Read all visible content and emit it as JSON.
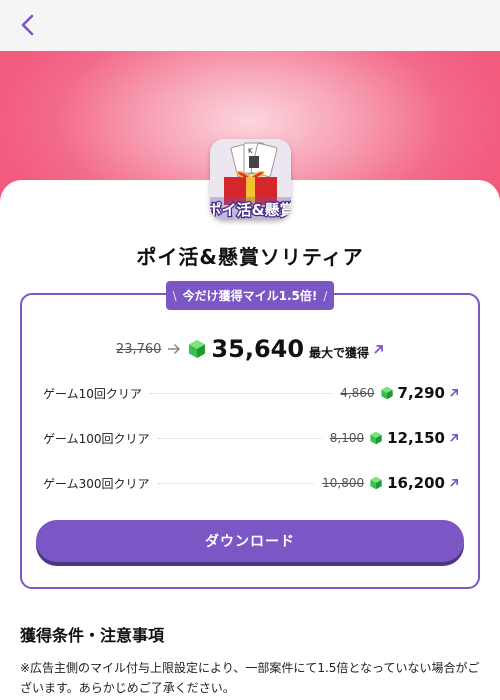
{
  "app": {
    "title": "ポイ活&懸賞ソリティア",
    "icon_text": "ポイ活&懸賞"
  },
  "badge": {
    "left": "\\",
    "text": "今だけ獲得マイル1.5倍!",
    "right": "/"
  },
  "main": {
    "old": "23,760",
    "new": "35,640",
    "suffix": "最大で獲得"
  },
  "rows": [
    {
      "label": "ゲーム10回クリア",
      "old": "4,860",
      "new": "7,290"
    },
    {
      "label": "ゲーム100回クリア",
      "old": "8,100",
      "new": "12,150"
    },
    {
      "label": "ゲーム300回クリア",
      "old": "10,800",
      "new": "16,200"
    }
  ],
  "download_label": "ダウンロード",
  "conditions": {
    "title": "獲得条件・注意事項",
    "notice": "※広告主側のマイル付与上限設定により、一部案件にて1.5倍となっていない場合がございます。あらかじめご了承ください。"
  },
  "colors": {
    "accent": "#7b56c5",
    "hero": "#f25a7e",
    "gem": "#35c24a"
  },
  "icons": {
    "back": "chevron-left-icon",
    "gem": "green-gem-icon",
    "external": "arrow-up-right-icon",
    "arrow": "arrow-right-icon"
  }
}
